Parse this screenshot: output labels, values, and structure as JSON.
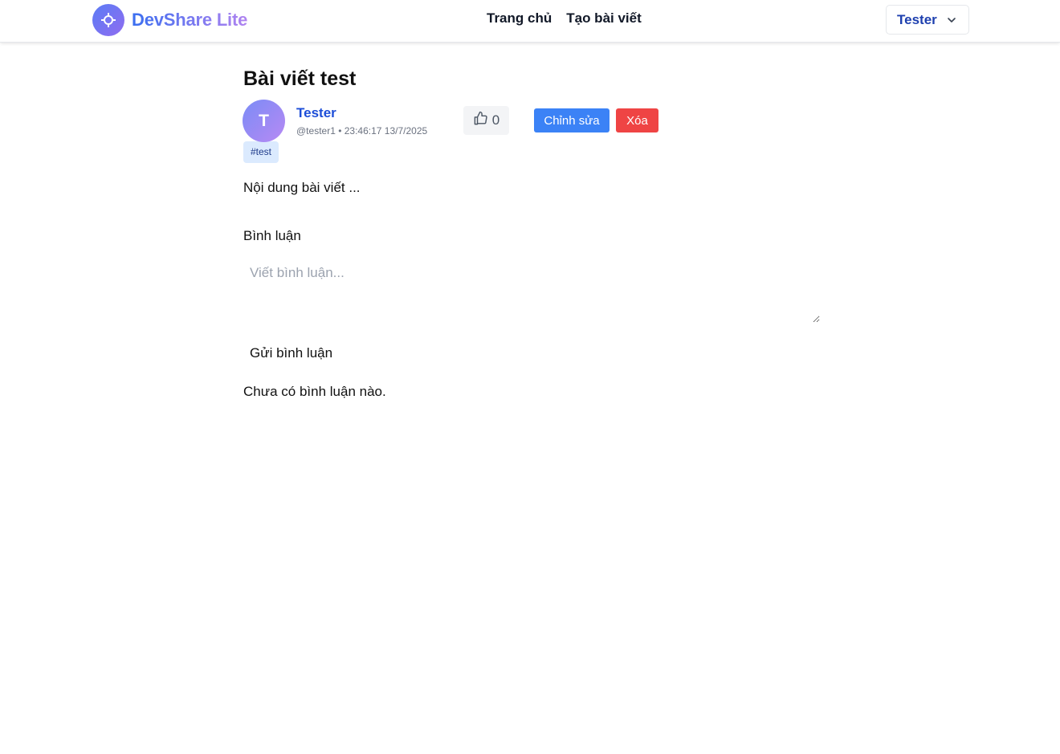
{
  "header": {
    "brand": "DevShare Lite",
    "nav": [
      "Trang chủ",
      "Tạo bài viết"
    ],
    "user_menu": "Tester"
  },
  "post": {
    "title": "Bài viết test",
    "author": {
      "initial": "T",
      "name": "Tester",
      "handle_time": "@tester1 • 23:46:17 13/7/2025"
    },
    "likes": "0",
    "edit_label": "Chỉnh sửa",
    "delete_label": "Xóa",
    "tags": [
      "#test"
    ],
    "content": "Nội dung bài viết ..."
  },
  "comments": {
    "heading": "Bình luận",
    "placeholder": "Viết bình luận...",
    "value": "",
    "submit_label": "Gửi bình luận",
    "empty_text": "Chưa có bình luận nào."
  },
  "colors": {
    "brand_start": "#3b6ff0",
    "brand_end": "#b083f0",
    "primary": "#3b82f6",
    "danger": "#ef4444",
    "author_link": "#1d4ed8",
    "tag_bg": "#dbeafe"
  },
  "icons": {
    "brand": "crosshair-icon",
    "user_menu": "chevron-down-icon",
    "like": "thumbs-up-icon"
  }
}
